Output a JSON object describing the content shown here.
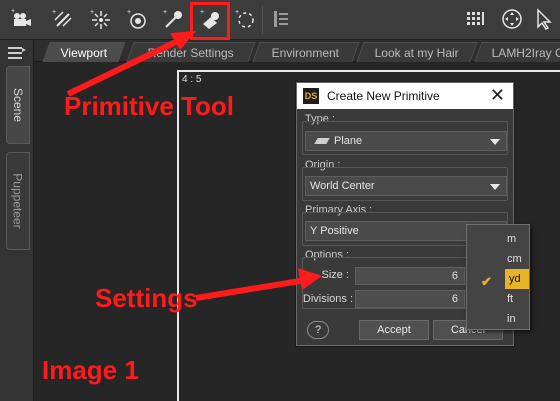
{
  "toolbar": {
    "buttons": [
      {
        "name": "camera-icon"
      },
      {
        "name": "distant-light-icon"
      },
      {
        "name": "point-light-icon"
      },
      {
        "name": "spotlight-icon"
      },
      {
        "name": "light-tool-icon"
      },
      {
        "name": "primitive-tool-icon"
      },
      {
        "name": "node-tool-icon"
      },
      {
        "name": "layout-icon"
      },
      {
        "name": "grid-icon"
      },
      {
        "name": "universal-tool-icon"
      },
      {
        "name": "pointer-icon"
      }
    ]
  },
  "side_tabs": {
    "scene": "Scene",
    "puppeteer": "Puppeteer"
  },
  "tabs": [
    "Viewport",
    "Render Settings",
    "Environment",
    "Look at my Hair",
    "LAMH2Iray C"
  ],
  "viewport": {
    "aspect": "4 : 5"
  },
  "dialog": {
    "logo": "DS",
    "title": "Create New Primitive",
    "close": "✕",
    "type": {
      "label": "Type :",
      "value": "Plane"
    },
    "origin": {
      "label": "Origin :",
      "value": "World Center"
    },
    "axis": {
      "label": "Primary Axis :",
      "value": "Y Positive"
    },
    "options": {
      "label": "Options :",
      "size_label": "Size :",
      "size_value": "6",
      "divisions_label": "Divisions :",
      "divisions_value": "6"
    },
    "help": "?",
    "accept": "Accept",
    "cancel": "Cancel"
  },
  "units_menu": {
    "options": [
      "m",
      "cm",
      "yd",
      "ft",
      "in"
    ],
    "selected": "yd"
  },
  "annotations": {
    "primitive_tool": "Primitive Tool",
    "settings": "Settings",
    "image_label": "Image 1"
  },
  "colors": {
    "annotation_red": "#ff1b1b",
    "highlight_yellow": "#e6b429"
  }
}
